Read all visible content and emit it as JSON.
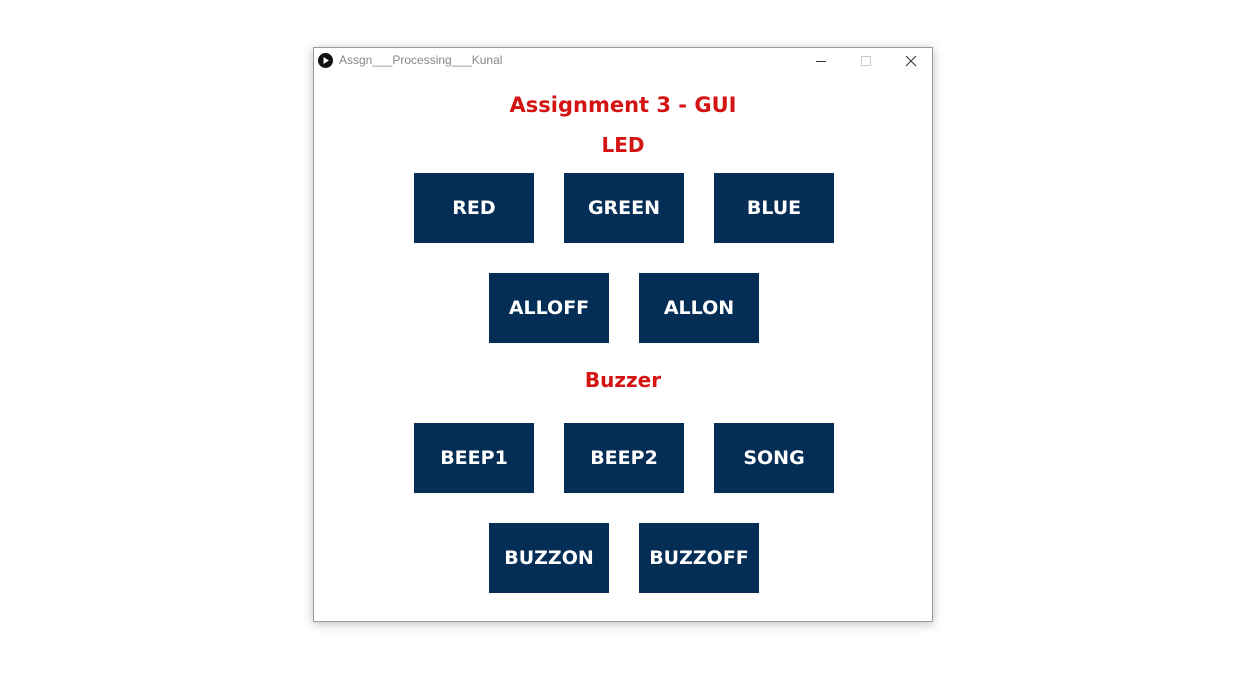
{
  "window": {
    "title": "Assgn___Processing___Kunal",
    "controls": {
      "minimize": "minimize-icon",
      "maximize": "maximize-icon",
      "close": "close-icon"
    }
  },
  "app": {
    "title": "Assignment 3 - GUI",
    "led_section": {
      "label": "LED",
      "buttons": [
        "RED",
        "GREEN",
        "BLUE",
        "ALLOFF",
        "ALLON"
      ]
    },
    "buzzer_section": {
      "label": "Buzzer",
      "buttons": [
        "BEEP1",
        "BEEP2",
        "SONG",
        "BUZZON",
        "BUZZOFF"
      ]
    }
  },
  "colors": {
    "heading": "#d41313",
    "button_bg": "#052e57",
    "button_text": "#ffffff"
  }
}
